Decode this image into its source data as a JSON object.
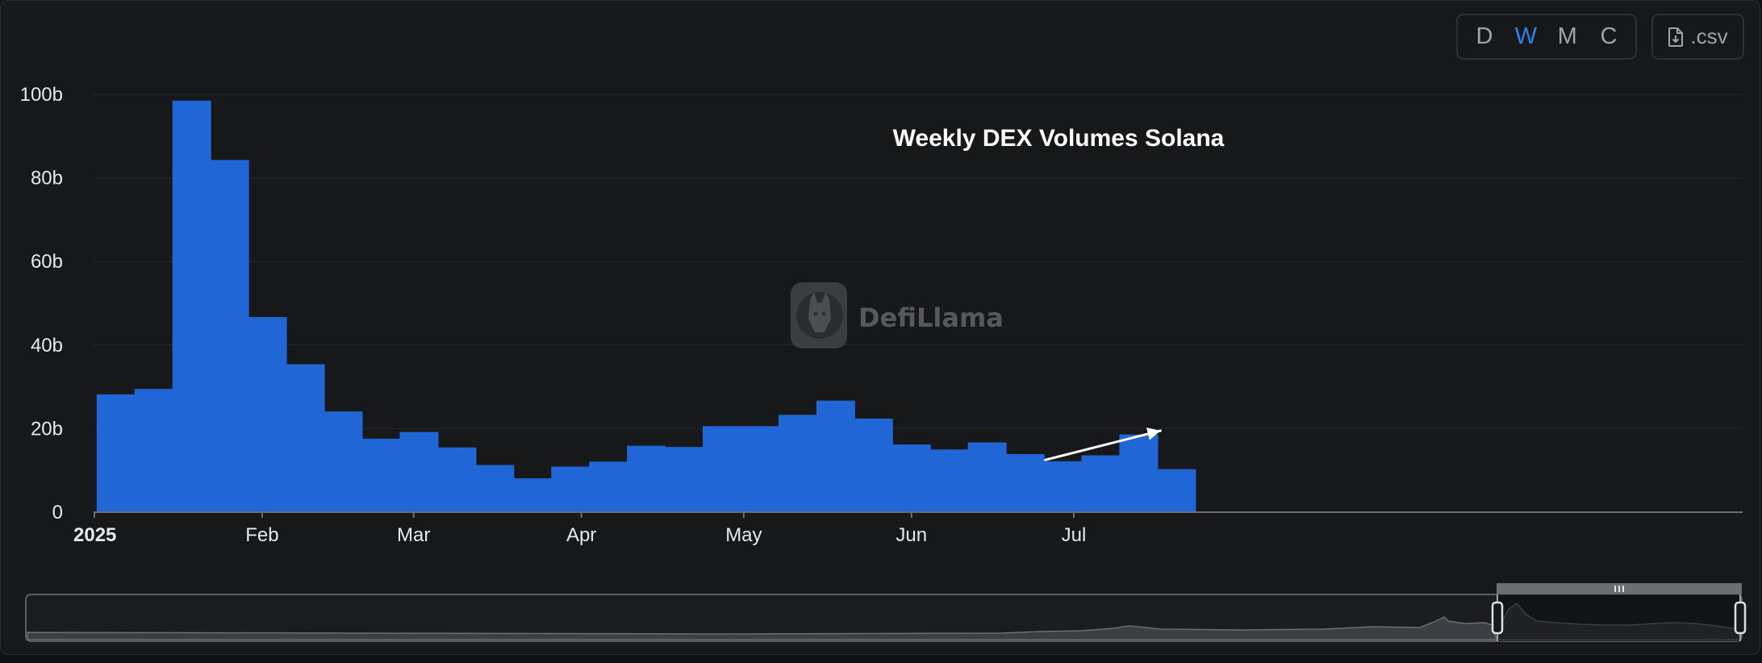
{
  "toolbar": {
    "granularity": [
      {
        "label": "D",
        "active": false
      },
      {
        "label": "W",
        "active": true
      },
      {
        "label": "M",
        "active": false
      },
      {
        "label": "C",
        "active": false
      }
    ],
    "csv_label": ".csv"
  },
  "watermark": {
    "text": "DefiLlama"
  },
  "colors": {
    "bar": "#2166d6",
    "active": "#2f80ed"
  },
  "chart_data": {
    "type": "bar",
    "title": "Weekly DEX Volumes Solana",
    "xlabel": "",
    "ylabel": "",
    "ylim": [
      0,
      100
    ],
    "unit": "b",
    "yticks": [
      {
        "value": 0,
        "label": "0"
      },
      {
        "value": 20,
        "label": "20b"
      },
      {
        "value": 40,
        "label": "40b"
      },
      {
        "value": 60,
        "label": "60b"
      },
      {
        "value": 80,
        "label": "80b"
      },
      {
        "value": 100,
        "label": "100b"
      }
    ],
    "xticks": [
      {
        "label": "2025",
        "date": "2025-01-01",
        "bold": true
      },
      {
        "label": "Feb",
        "date": "2025-02-01",
        "bold": false
      },
      {
        "label": "Mar",
        "date": "2025-03-01",
        "bold": false
      },
      {
        "label": "Apr",
        "date": "2025-04-01",
        "bold": false
      },
      {
        "label": "May",
        "date": "2025-05-01",
        "bold": false
      },
      {
        "label": "Jun",
        "date": "2025-06-01",
        "bold": false
      },
      {
        "label": "Jul",
        "date": "2025-07-01",
        "bold": false
      }
    ],
    "x": [
      "2025-01-05",
      "2025-01-12",
      "2025-01-19",
      "2025-01-26",
      "2025-02-02",
      "2025-02-09",
      "2025-02-16",
      "2025-02-23",
      "2025-03-02",
      "2025-03-09",
      "2025-03-16",
      "2025-03-23",
      "2025-03-30",
      "2025-04-06",
      "2025-04-13",
      "2025-04-20",
      "2025-04-27",
      "2025-05-04",
      "2025-05-11",
      "2025-05-18",
      "2025-05-25",
      "2025-06-01",
      "2025-06-08",
      "2025-06-15",
      "2025-06-22",
      "2025-06-29",
      "2025-07-06",
      "2025-07-13",
      "2025-07-20"
    ],
    "values": [
      28.2,
      29.5,
      98.5,
      84.3,
      46.7,
      35.4,
      24.1,
      17.6,
      19.2,
      15.5,
      11.3,
      8.1,
      10.9,
      12.1,
      15.9,
      15.6,
      20.6,
      20.6,
      23.3,
      26.7,
      22.4,
      16.2,
      15.0,
      16.7,
      13.9,
      12.2,
      13.6,
      18.6,
      10.3
    ],
    "grid": true,
    "legend": "none",
    "annotations": [
      {
        "type": "arrow",
        "from": {
          "x": "2025-06-29",
          "y": 12.5
        },
        "to": {
          "x": "2025-07-20",
          "y": 19.5
        }
      }
    ]
  }
}
